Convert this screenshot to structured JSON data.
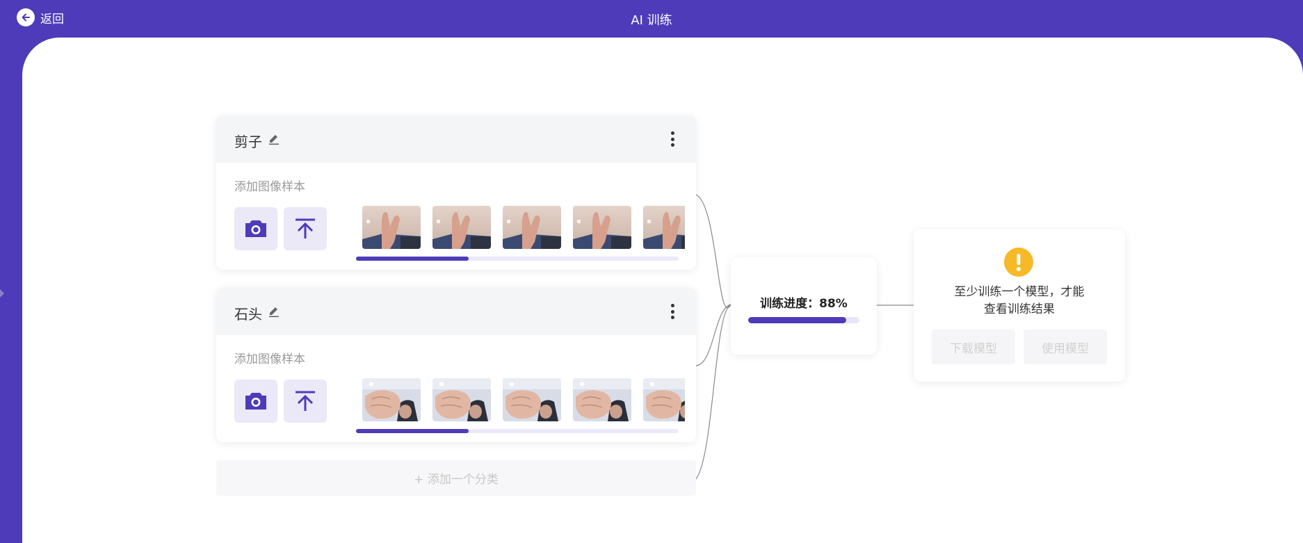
{
  "header": {
    "back_label": "返回",
    "title": "AI 训练"
  },
  "classes": [
    {
      "name": "剪子",
      "samples_label": "添加图像样本",
      "fill_percent": 35
    },
    {
      "name": "石头",
      "samples_label": "添加图像样本",
      "fill_percent": 35
    }
  ],
  "add_class_label": "+ 添加一个分类",
  "training": {
    "progress_label": "训练进度：88%",
    "progress_percent": 88
  },
  "result": {
    "message_line1": "至少训练一个模型，才能",
    "message_line2": "查看训练结果",
    "download_label": "下载模型",
    "use_label": "使用模型"
  },
  "colors": {
    "brand": "#4d3bb9",
    "warning": "#f7b928"
  }
}
